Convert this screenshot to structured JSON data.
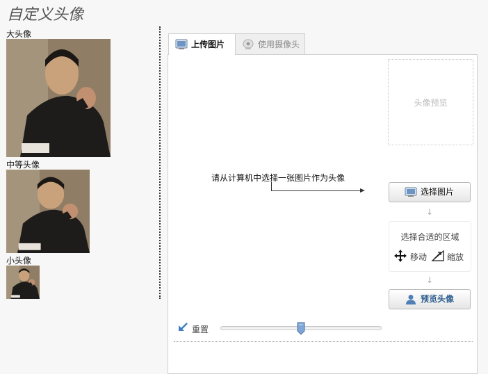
{
  "page": {
    "title": "自定义头像"
  },
  "avatars": {
    "large": {
      "label": "大头像"
    },
    "medium": {
      "label": "中等头像"
    },
    "small": {
      "label": "小头像"
    }
  },
  "tabs": [
    {
      "label": "上传图片",
      "active": true,
      "icon": "picture-icon"
    },
    {
      "label": "使用摄像头",
      "active": false,
      "icon": "webcam-icon"
    }
  ],
  "editor": {
    "preview_placeholder": "头像预览",
    "instruction": "请从计算机中选择一张图片作为头像",
    "select_button": "选择图片",
    "arrow_down": "↓",
    "region_title": "选择合适的区域",
    "move_label": "移动",
    "zoom_label": "缩放",
    "preview_button": "预览头像",
    "reset_label": "重置",
    "zoom_level": 0.5
  },
  "colors": {
    "accent": "#2f5f8f",
    "panel_border": "#cfcfcf"
  }
}
